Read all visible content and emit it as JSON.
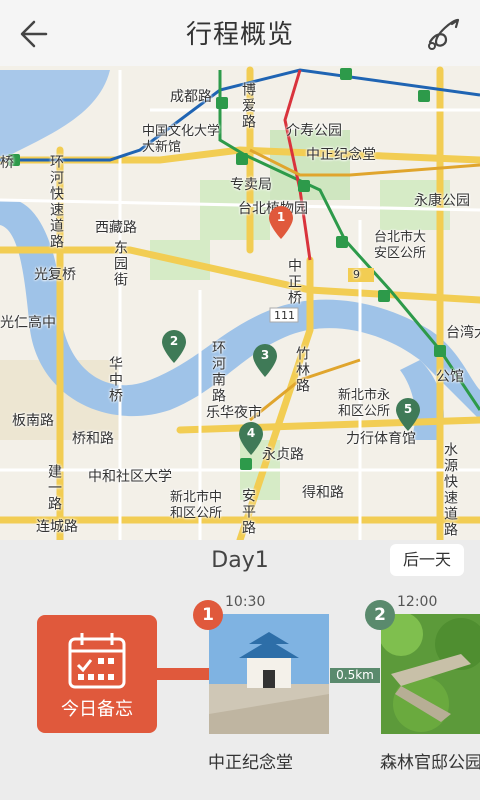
{
  "header": {
    "title": "行程概览",
    "back_icon": "back-arrow-icon",
    "function_icon": "route-swirl-icon"
  },
  "map": {
    "streets": {
      "chengdu": "成都路",
      "boai": "博爱路",
      "xizang": "西藏路",
      "dongyuan": "东园街",
      "guangfu_bridge": "光复桥",
      "guangren": "光仁高中",
      "huazhong_bridge": "华中桥",
      "banshan": "板南路",
      "qiaohe": "桥和路",
      "jianyi": "建一路",
      "liancheng": "连城路",
      "huanhe": "环河快速道路",
      "zhongzheng_bridge": "中正桥",
      "huanhe_s": "环河南路",
      "zhulin": "竹林路",
      "yongzhen": "永贞路",
      "dehe": "得和路",
      "anping": "安平路",
      "shuiyuan": "水源快速道路",
      "gongguan": "公馆",
      "bridge_left": "桥"
    },
    "places": {
      "cul_univ": "中国文化大学大新馆",
      "jieshou": "介寿公园",
      "cks_memorial": "中正纪念堂",
      "post_office": "专卖局",
      "botanical": "台北植物园",
      "yongkang": "永康公园",
      "daan": "台北市大安区公所",
      "taiwan_univ": "台湾大学",
      "lehua": "乐华夜市",
      "yonghe_office": "新北市永和区公所",
      "stadium": "力行体育馆",
      "zhonghe_univ": "中和社区大学",
      "zhonghe_office": "新北市中和区公所"
    },
    "road_shields": [
      "9",
      "111"
    ],
    "markers": [
      {
        "number": "1",
        "color": "#e0593c"
      },
      {
        "number": "2",
        "color": "#3f7a57"
      },
      {
        "number": "3",
        "color": "#3f7a57"
      },
      {
        "number": "4",
        "color": "#3f7a57"
      },
      {
        "number": "5",
        "color": "#3f7a57"
      }
    ]
  },
  "itinerary": {
    "day_label": "Day1",
    "next_day_button": "后一天",
    "memo_label": "今日备忘",
    "stops": [
      {
        "number": "1",
        "time": "10:30",
        "name": "中正纪念堂",
        "badge_color": "#e0593c"
      },
      {
        "number": "2",
        "time": "12:00",
        "name": "森林官邸公园",
        "badge_color": "#5a8a6d"
      }
    ],
    "distance": "0.5km"
  }
}
